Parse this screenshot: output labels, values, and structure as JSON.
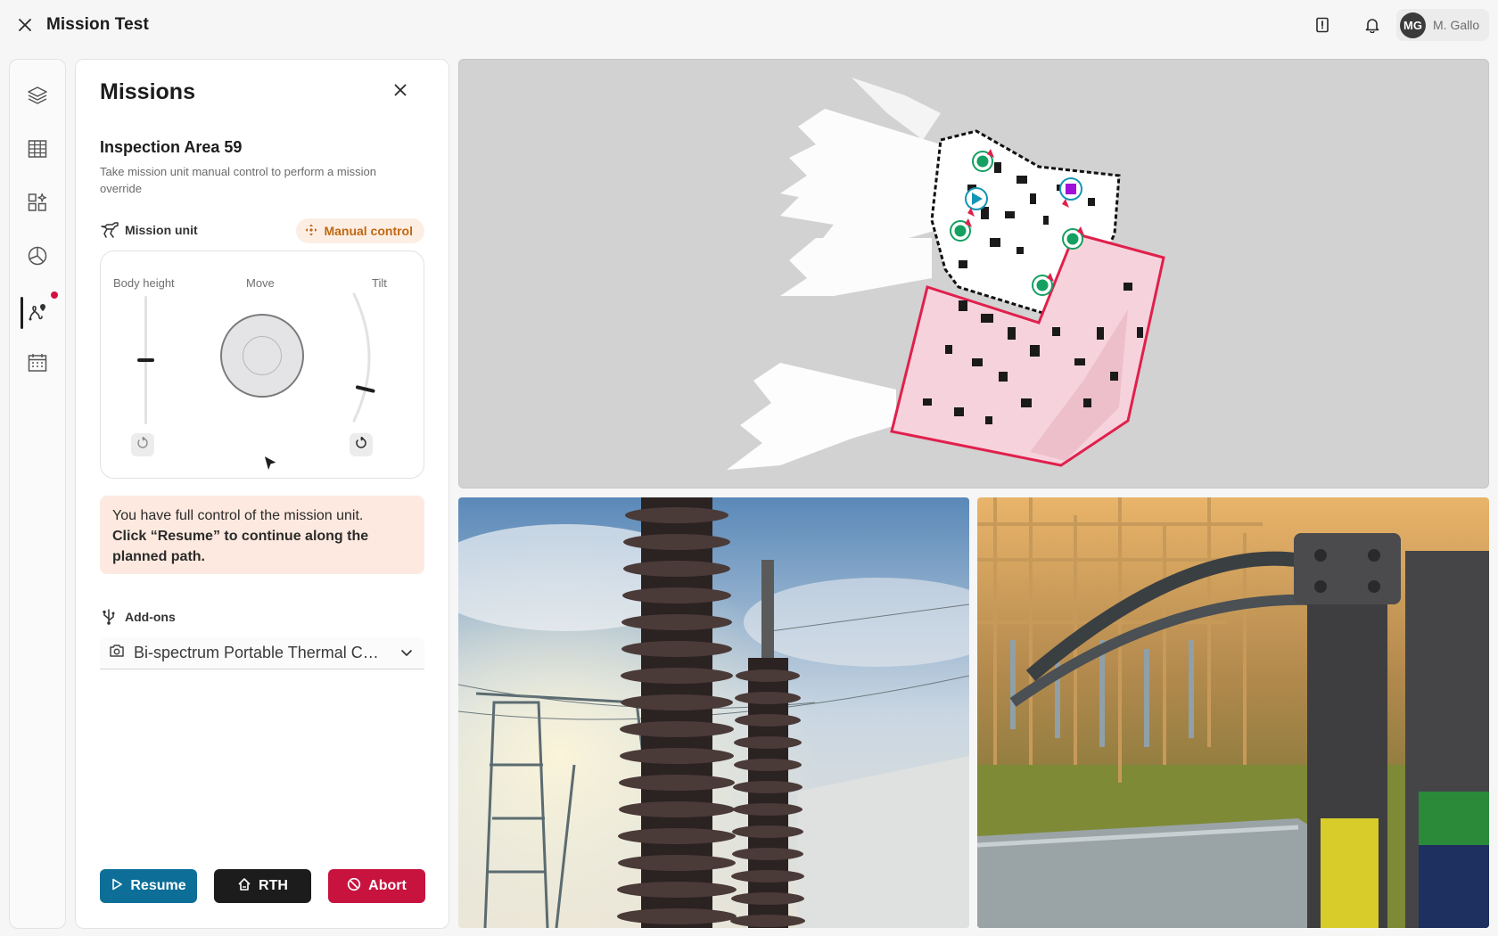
{
  "app": {
    "title": "Mission Test"
  },
  "header": {
    "user": {
      "initials": "MG",
      "name": "M. Gallo"
    },
    "icons": [
      "report-icon",
      "bell-icon"
    ]
  },
  "rail": {
    "items": [
      "layers-icon",
      "table-icon",
      "widgets-icon",
      "analytics-icon",
      "missions-icon",
      "calendar-icon"
    ],
    "active_index": 4,
    "notification_color": "#d3113f"
  },
  "missions": {
    "title": "Missions",
    "mission_name": "Inspection Area 59",
    "description": "Take mission unit manual control to perform a mission override",
    "unit": {
      "label": "Mission unit",
      "mode_badge": "Manual control"
    },
    "controls": {
      "body_height_label": "Body height",
      "move_label": "Move",
      "tilt_label": "Tilt",
      "body_height_level": 0.5,
      "tilt_level": 0.75
    },
    "notice": {
      "line1": "You have full control of the mission unit.",
      "line2": "Click “Resume” to continue along the planned path."
    },
    "addons": {
      "label": "Add-ons",
      "selected": "Bi-spectrum Portable Thermal Camera"
    },
    "actions": {
      "resume": "Resume",
      "rth": "RTH",
      "abort": "Abort"
    }
  },
  "colors": {
    "accent_blue": "#0d6f98",
    "danger": "#c8133f",
    "badge_bg": "#fdeee4",
    "badge_text": "#c06812",
    "waypoint": "#14a060",
    "zone": "#e0204c"
  }
}
